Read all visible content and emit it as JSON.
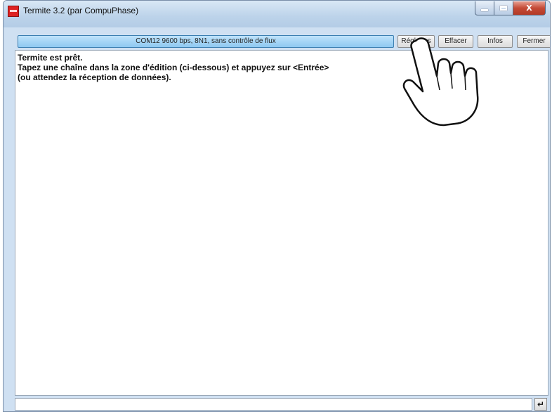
{
  "window": {
    "title": "Termite 3.2 (par CompuPhase)",
    "controls": {
      "close_glyph": "X"
    }
  },
  "toolbar": {
    "status": "COM12 9600 bps, 8N1, sans contrôle de flux",
    "buttons": {
      "reglages": "Réglages",
      "effacer": "Effacer",
      "infos": "Infos",
      "fermer": "Fermer"
    }
  },
  "output": {
    "lines": [
      "Termite est prêt.",
      "Tapez une chaîne dans la zone d'édition (ci-dessous) et appuyez sur <Entrée>",
      "(ou attendez la réception de données)."
    ]
  },
  "input": {
    "value": "",
    "enter_glyph": "↵"
  },
  "icons": {
    "app": "termite-app-icon",
    "pointer": "hand-pointer-icon"
  }
}
